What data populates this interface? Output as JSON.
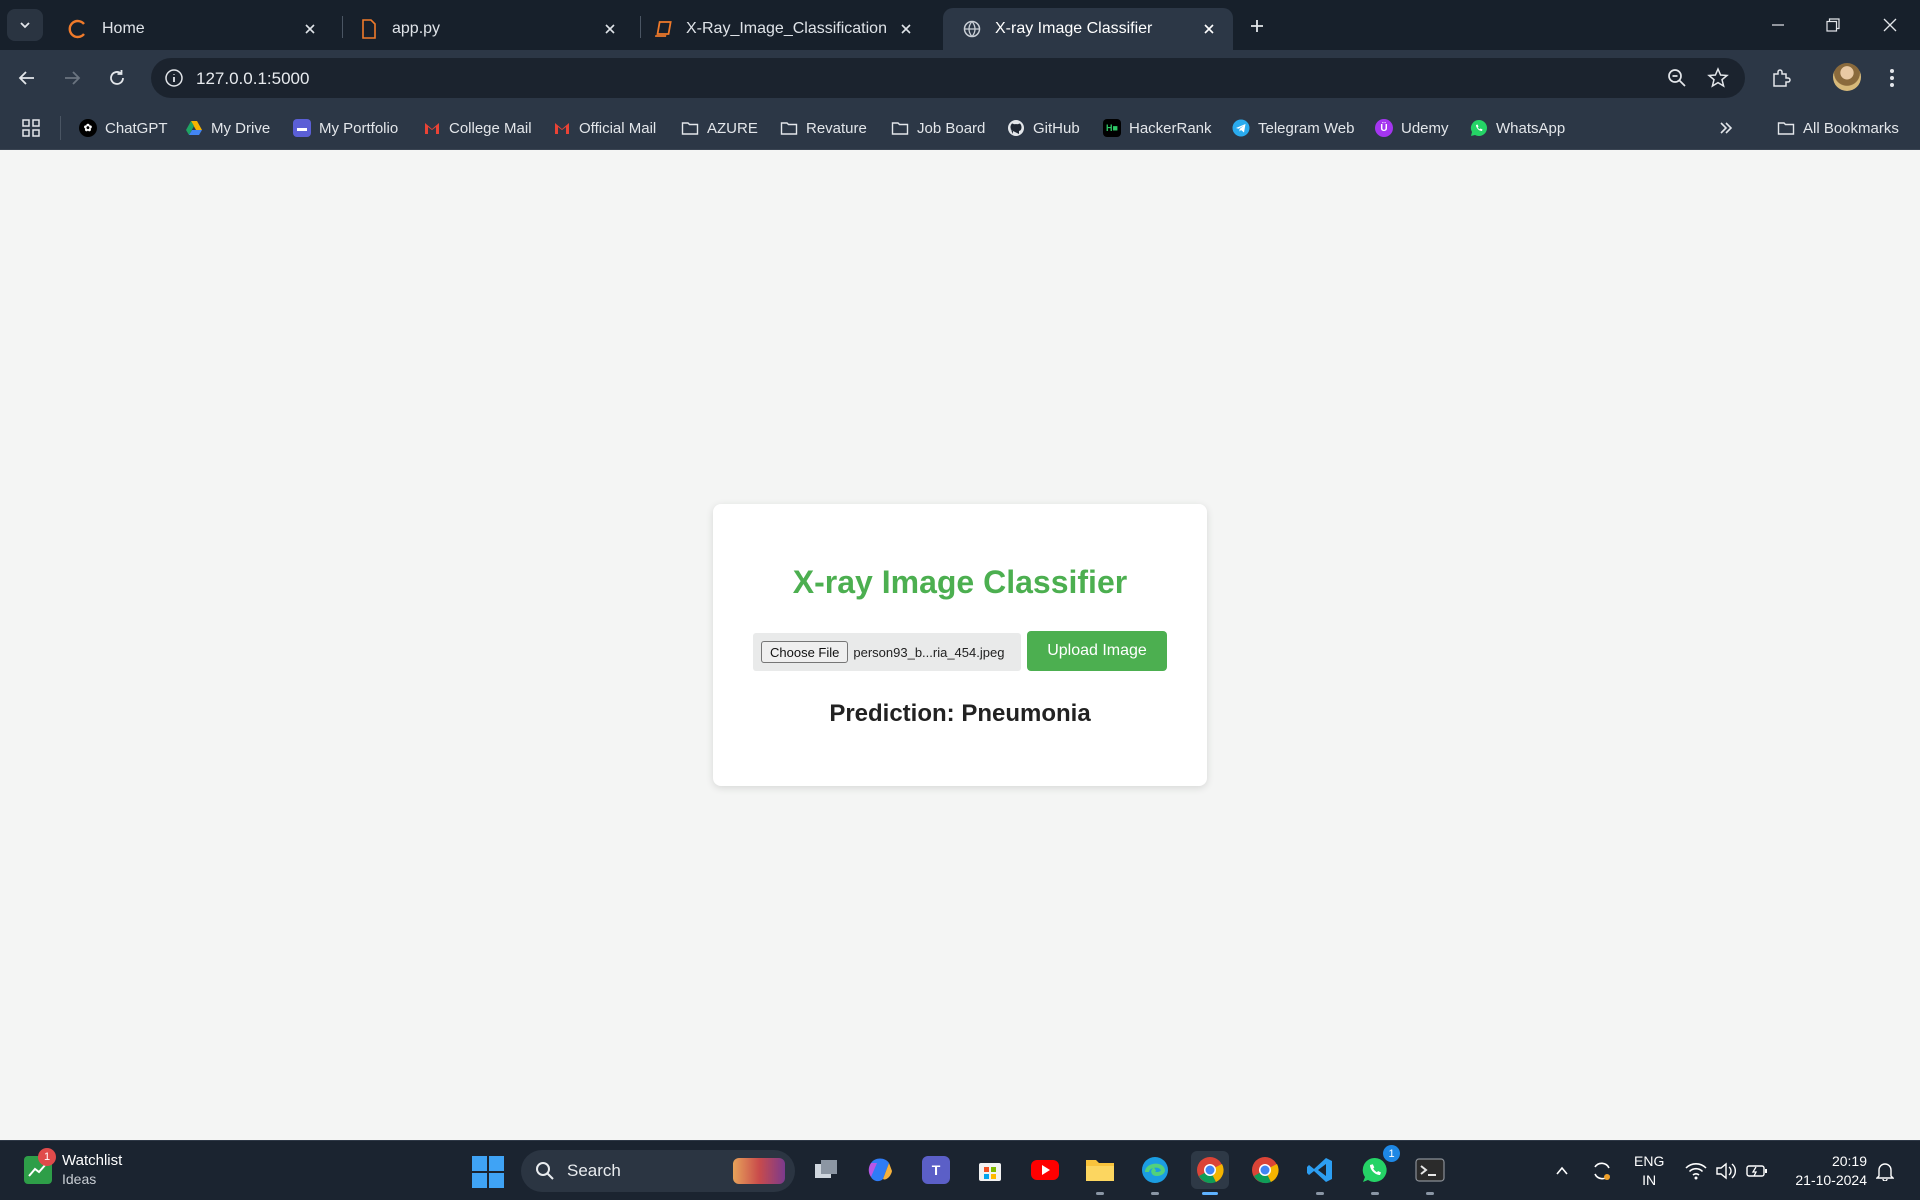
{
  "browser": {
    "tabs": [
      {
        "title": "Home",
        "icon": "spinner-icon",
        "active": false
      },
      {
        "title": "app.py",
        "icon": "file-icon",
        "active": false
      },
      {
        "title": "X-Ray_Image_Classification",
        "icon": "notebook-icon",
        "active": false
      },
      {
        "title": "X-ray Image Classifier",
        "icon": "globe-icon",
        "active": true
      }
    ],
    "url": "127.0.0.1:5000",
    "bookmarks": [
      {
        "label": "ChatGPT",
        "icon": "chatgpt-icon"
      },
      {
        "label": "My Drive",
        "icon": "drive-icon"
      },
      {
        "label": "My Portfolio",
        "icon": "portfolio-icon"
      },
      {
        "label": "College Mail",
        "icon": "gmail-icon"
      },
      {
        "label": "Official Mail",
        "icon": "gmail-icon"
      },
      {
        "label": "AZURE",
        "icon": "folder-icon"
      },
      {
        "label": "Revature",
        "icon": "folder-icon"
      },
      {
        "label": "Job Board",
        "icon": "folder-icon"
      },
      {
        "label": "GitHub",
        "icon": "github-icon"
      },
      {
        "label": "HackerRank",
        "icon": "hackerrank-icon"
      },
      {
        "label": "Telegram Web",
        "icon": "telegram-icon"
      },
      {
        "label": "Udemy",
        "icon": "udemy-icon"
      },
      {
        "label": "WhatsApp",
        "icon": "whatsapp-icon"
      }
    ],
    "all_bookmarks_label": "All Bookmarks"
  },
  "page": {
    "title": "X-ray Image Classifier",
    "choose_file_label": "Choose File",
    "file_name": "person93_b...ria_454.jpeg",
    "upload_label": "Upload Image",
    "prediction": "Prediction: Pneumonia",
    "accent_color": "#4caf50"
  },
  "taskbar": {
    "widget_title": "Watchlist",
    "widget_subtitle": "Ideas",
    "widget_badge": "1",
    "search_label": "Search",
    "whatsapp_badge": "1",
    "lang_line1": "ENG",
    "lang_line2": "IN",
    "time": "20:19",
    "date": "21-10-2024"
  }
}
